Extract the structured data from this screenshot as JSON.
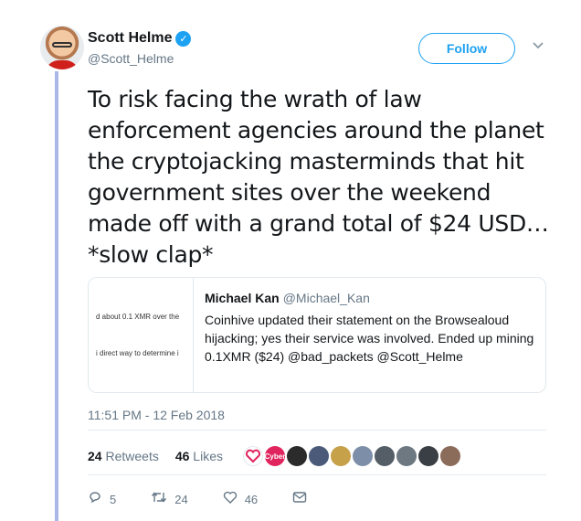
{
  "author": {
    "name": "Scott Helme",
    "handle": "@Scott_Helme",
    "verified_icon": "verified-badge-icon"
  },
  "follow_label": "Follow",
  "tweet_text": "To risk facing the wrath of law enforcement agencies around the planet the cryptojacking masterminds that hit government sites over the weekend made off with a grand total of $24 USD… *slow clap*",
  "quote": {
    "name": "Michael Kan",
    "handle": "@Michael_Kan",
    "text": "Coinhive updated their statement on the Browsealoud hijacking; yes their service was involved. Ended up mining 0.1XMR ($24) @bad_packets @Scott_Helme",
    "media_lines": [
      "d about 0.1 XMR over the",
      "i direct way to determine i"
    ]
  },
  "timestamp": "11:51 PM - 12 Feb 2018",
  "stats": {
    "retweets_count": "24",
    "retweets_label": "Retweets",
    "likes_count": "46",
    "likes_label": "Likes"
  },
  "liker_avatars": [
    {
      "name": "liker-avatar-1",
      "color": "#ffffff"
    },
    {
      "name": "liker-avatar-2",
      "color": "#e0245e",
      "text": "Cyber"
    },
    {
      "name": "liker-avatar-3",
      "color": "#2b2b2b"
    },
    {
      "name": "liker-avatar-4",
      "color": "#4a5a78"
    },
    {
      "name": "liker-avatar-5",
      "color": "#c7a04a"
    },
    {
      "name": "liker-avatar-6",
      "color": "#7d8ea8"
    },
    {
      "name": "liker-avatar-7",
      "color": "#555d66"
    },
    {
      "name": "liker-avatar-8",
      "color": "#6e7881"
    },
    {
      "name": "liker-avatar-9",
      "color": "#3a3f45"
    },
    {
      "name": "liker-avatar-10",
      "color": "#8b6b5a"
    }
  ],
  "actions": {
    "reply_count": "5",
    "retweet_count": "24",
    "like_count": "46"
  },
  "colors": {
    "accent": "#1da1f2",
    "secondary_text": "#657786",
    "thread_line": "#aab8e8"
  }
}
